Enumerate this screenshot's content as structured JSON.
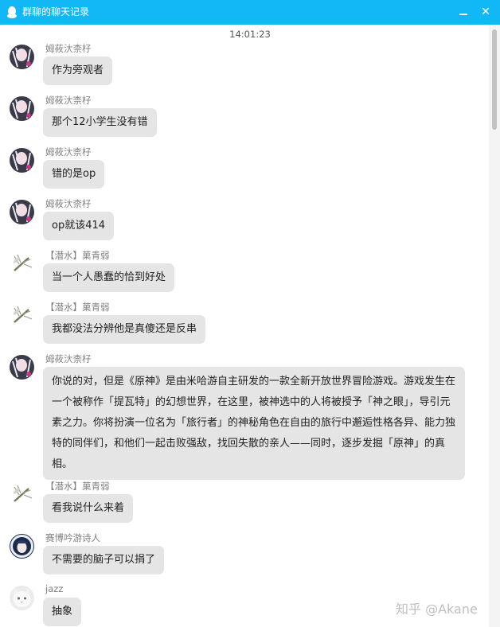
{
  "window": {
    "title": "群聊的聊天记录"
  },
  "timestamp": "14:01:23",
  "messages": [
    {
      "sender": "姆莜汏柰杍",
      "text": "作为旁观者",
      "avatar": "anime-avatar"
    },
    {
      "sender": "姆莜汏柰杍",
      "text": "那个12小学生没有错",
      "avatar": "anime-avatar"
    },
    {
      "sender": "姆莜汏柰杍",
      "text": "错的是op",
      "avatar": "anime-avatar"
    },
    {
      "sender": "姆莜汏柰杍",
      "text": "op就该414",
      "avatar": "anime-avatar"
    },
    {
      "sender": "【潜水】菓青弱",
      "text": "当一个人愚蠢的恰到好处",
      "avatar": "insect-avatar"
    },
    {
      "sender": "【潜水】菓青弱",
      "text": "我都没法分辨他是真傻还是反串",
      "avatar": "insect-avatar"
    },
    {
      "sender": "姆莜汏柰杍",
      "text": "你说的对，但是《原神》是由米哈游自主研发的一款全新开放世界冒险游戏。游戏发生在一个被称作「提瓦特」的幻想世界，在这里，被神选中的人将被授予「神之眼」，导引元素之力。你将扮演一位名为「旅行者」的神秘角色在自由的旅行中邂逅性格各异、能力独特的同伴们，和他们一起击败强敌，找回失散的亲人——同时，逐步发掘「原神」的真相。",
      "avatar": "anime-avatar"
    },
    {
      "sender": "【潜水】菓青弱",
      "text": "看我说什么来着",
      "avatar": "insect-avatar"
    },
    {
      "sender": "赛博吟游诗人",
      "text": "不需要的脑子可以捐了",
      "avatar": "bard-avatar"
    },
    {
      "sender": "jazz",
      "text": "抽象",
      "avatar": "cat-avatar"
    }
  ],
  "watermark": "知乎 @Akane",
  "colors": {
    "titlebar": "#12b7f5",
    "bubble": "#e5e5e5",
    "name": "#808080"
  }
}
